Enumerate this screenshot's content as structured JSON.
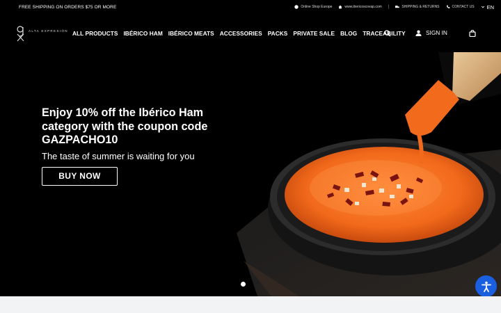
{
  "topbar": {
    "shipping_text": "FREE SHIPPING ON ORDERS $75 OR MORE",
    "online_shop": "Online Shop Europe",
    "website": "www.ibericoscovap.com",
    "separator": "|",
    "shipping_returns": "SHIPPING & RETURNS",
    "contact": "CONTACT US",
    "language": "EN"
  },
  "logo": {
    "text": "ALTA EXPRESIÓN"
  },
  "nav": {
    "items": [
      {
        "label": "ALL PRODUCTS"
      },
      {
        "label": "IBÉRICO HAM"
      },
      {
        "label": "IBÉRICO MEATS"
      },
      {
        "label": "ACCESSORIES"
      },
      {
        "label": "PACKS"
      },
      {
        "label": "PRIVATE SALE"
      },
      {
        "label": "BLOG"
      },
      {
        "label": "TRACEABILITY"
      }
    ],
    "signin": "SIGN IN"
  },
  "hero": {
    "title_line1": "Enjoy 10% off the Ibérico Ham",
    "title_line2": "category with the coupon code",
    "title_line3": "GAZPACHO10",
    "subtitle": "The taste of summer is waiting for you",
    "button": "BUY NOW"
  },
  "colors": {
    "accessibility_button": "#1a5fe0",
    "gazpacho": "#f26a1b",
    "background": "#000000"
  },
  "icons": [
    "globe-icon",
    "home-icon",
    "truck-icon",
    "phone-icon",
    "chevron-down-icon",
    "search-icon",
    "user-icon",
    "bag-icon",
    "accessibility-icon"
  ]
}
